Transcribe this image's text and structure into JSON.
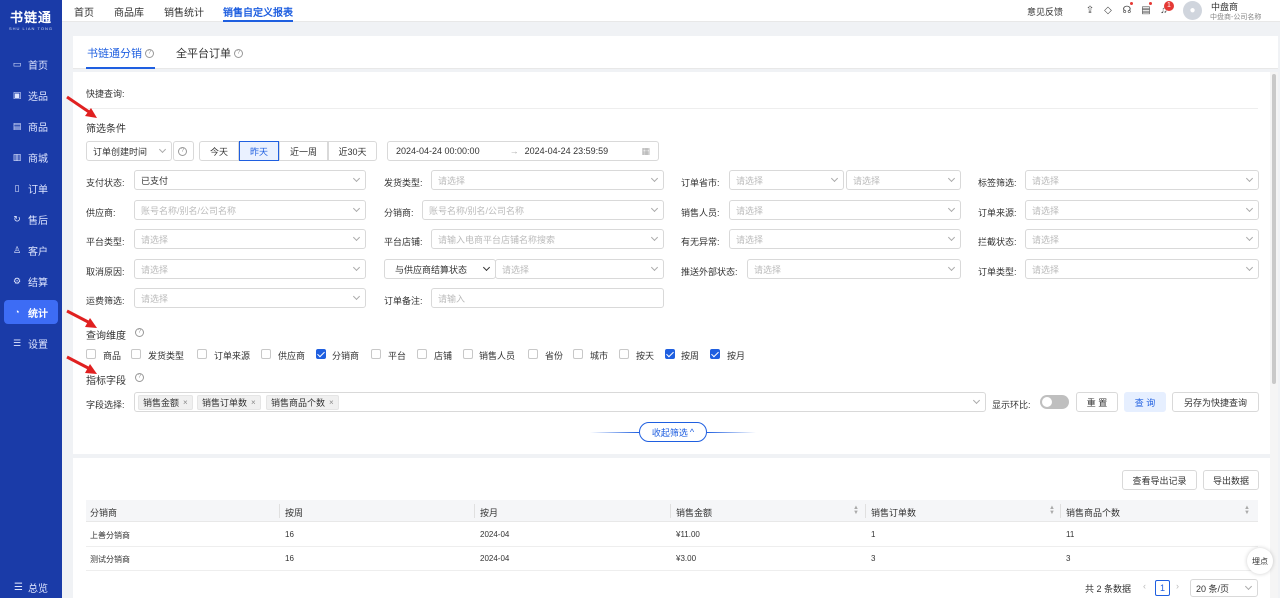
{
  "app": {
    "logo": "书链通",
    "logo_sub": "SHU LIAN TONG"
  },
  "sidebar": {
    "items": [
      {
        "label": "首页",
        "icon": "monitor-icon"
      },
      {
        "label": "选品",
        "icon": "select-icon"
      },
      {
        "label": "商品",
        "icon": "product-icon"
      },
      {
        "label": "商城",
        "icon": "store-icon"
      },
      {
        "label": "订单",
        "icon": "order-icon"
      },
      {
        "label": "售后",
        "icon": "after-sale-icon"
      },
      {
        "label": "客户",
        "icon": "customer-icon"
      },
      {
        "label": "结算",
        "icon": "settle-icon"
      },
      {
        "label": "统计",
        "icon": "stats-icon"
      },
      {
        "label": "设置",
        "icon": "settings-icon"
      }
    ],
    "collapse_label": "总览"
  },
  "topnav": {
    "items": [
      "首页",
      "商品库",
      "销售统计",
      "销售自定义报表"
    ],
    "active": 3
  },
  "header": {
    "feedback": "意见反馈",
    "badge_count": "1",
    "user_name": "中盘商",
    "company": "中盘商-公司名称"
  },
  "tabs": [
    {
      "label": "书链通分销"
    },
    {
      "label": "全平台订单"
    }
  ],
  "quick_query": "快捷查询:",
  "filter": {
    "title": "筛选条件",
    "date_type": "订单创建时间",
    "ranges": [
      "今天",
      "昨天",
      "近一周",
      "近30天"
    ],
    "date_start": "2024-04-24 00:00:00",
    "date_sep": "→",
    "date_end": "2024-04-24 23:59:59",
    "fields": {
      "pay_status": {
        "label": "支付状态:",
        "value": "已支付"
      },
      "ship_type": {
        "label": "发货类型:",
        "placeholder": "请选择"
      },
      "province": {
        "label": "订单省市:",
        "placeholder": "请选择",
        "placeholder2": "请选择"
      },
      "tag": {
        "label": "标签筛选:",
        "placeholder": "请选择"
      },
      "supplier": {
        "label": "供应商:",
        "placeholder": "账号名称/别名/公司名称"
      },
      "distributor": {
        "label": "分销商:",
        "placeholder": "账号名称/别名/公司名称"
      },
      "sales": {
        "label": "销售人员:",
        "placeholder": "请选择"
      },
      "source": {
        "label": "订单来源:",
        "placeholder": "请选择"
      },
      "platform": {
        "label": "平台类型:",
        "placeholder": "请选择"
      },
      "shop": {
        "label": "平台店铺:",
        "placeholder": "请输入电商平台店铺名称搜索"
      },
      "abnormal": {
        "label": "有无异常:",
        "placeholder": "请选择"
      },
      "intercept": {
        "label": "拦截状态:",
        "placeholder": "请选择"
      },
      "cancel": {
        "label": "取消原因:",
        "placeholder": "请选择"
      },
      "settle_select": {
        "value": "与供应商结算状态",
        "placeholder": "请选择"
      },
      "push": {
        "label": "推送外部状态:",
        "placeholder": "请选择"
      },
      "order_type": {
        "label": "订单类型:",
        "placeholder": "请选择"
      },
      "freight": {
        "label": "运费筛选:",
        "placeholder": "请选择"
      },
      "remark": {
        "label": "订单备注:",
        "placeholder": "请输入"
      }
    }
  },
  "dimension": {
    "title": "查询维度",
    "items": [
      {
        "label": "商品",
        "checked": false
      },
      {
        "label": "发货类型",
        "checked": false
      },
      {
        "label": "订单来源",
        "checked": false
      },
      {
        "label": "供应商",
        "checked": false
      },
      {
        "label": "分销商",
        "checked": true
      },
      {
        "label": "平台",
        "checked": false
      },
      {
        "label": "店铺",
        "checked": false
      },
      {
        "label": "销售人员",
        "checked": false
      },
      {
        "label": "省份",
        "checked": false
      },
      {
        "label": "城市",
        "checked": false
      },
      {
        "label": "按天",
        "checked": false
      },
      {
        "label": "按周",
        "checked": true
      },
      {
        "label": "按月",
        "checked": true
      }
    ]
  },
  "metrics": {
    "title": "指标字段",
    "field_label": "字段选择:",
    "tags": [
      "销售金额",
      "销售订单数",
      "销售商品个数"
    ],
    "compare_label": "显示环比:",
    "reset": "重 置",
    "query": "查 询",
    "save_quick": "另存为快捷查询",
    "collapse": "收起筛选"
  },
  "table": {
    "export_log": "查看导出记录",
    "export": "导出数据",
    "columns": [
      "分销商",
      "按周",
      "按月",
      "销售金额",
      "销售订单数",
      "销售商品个数"
    ],
    "rows": [
      [
        "上善分销商",
        "16",
        "2024-04",
        "¥11.00",
        "1",
        "11"
      ],
      [
        "测试分销商",
        "16",
        "2024-04",
        "¥3.00",
        "3",
        "3"
      ]
    ]
  },
  "pagination": {
    "total": "共 2 条数据",
    "page": "1",
    "size": "20 条/页"
  },
  "float_btn": "埋点"
}
